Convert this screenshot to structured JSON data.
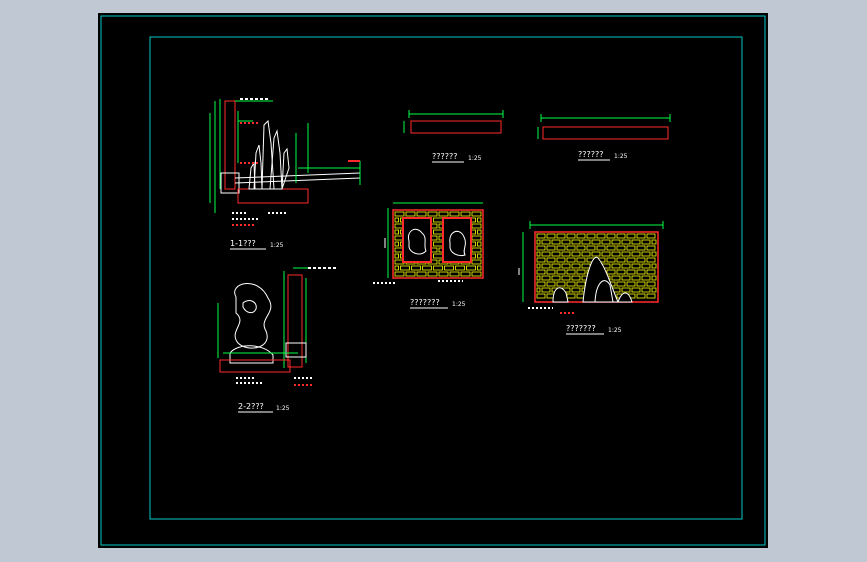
{
  "colors": {
    "background_outer": "#c0c8d4",
    "canvas": "#000000",
    "frame": "#00c8c8",
    "wall_outline": "#ff2a2a",
    "dimension": "#00ff44",
    "hatch": "#ffff00",
    "rock": "#ffffff",
    "text": "#ffffff"
  },
  "views": {
    "section_1": {
      "title": "1-1???",
      "scale": "1:25"
    },
    "section_2": {
      "title": "2-2???",
      "scale": "1:25"
    },
    "plan_a": {
      "title": "??????",
      "scale": "1:25"
    },
    "plan_b": {
      "title": "??????",
      "scale": "1:25"
    },
    "elevation_a": {
      "title": "???????",
      "scale": "1:25"
    },
    "elevation_b": {
      "title": "???????",
      "scale": "1:25"
    }
  }
}
